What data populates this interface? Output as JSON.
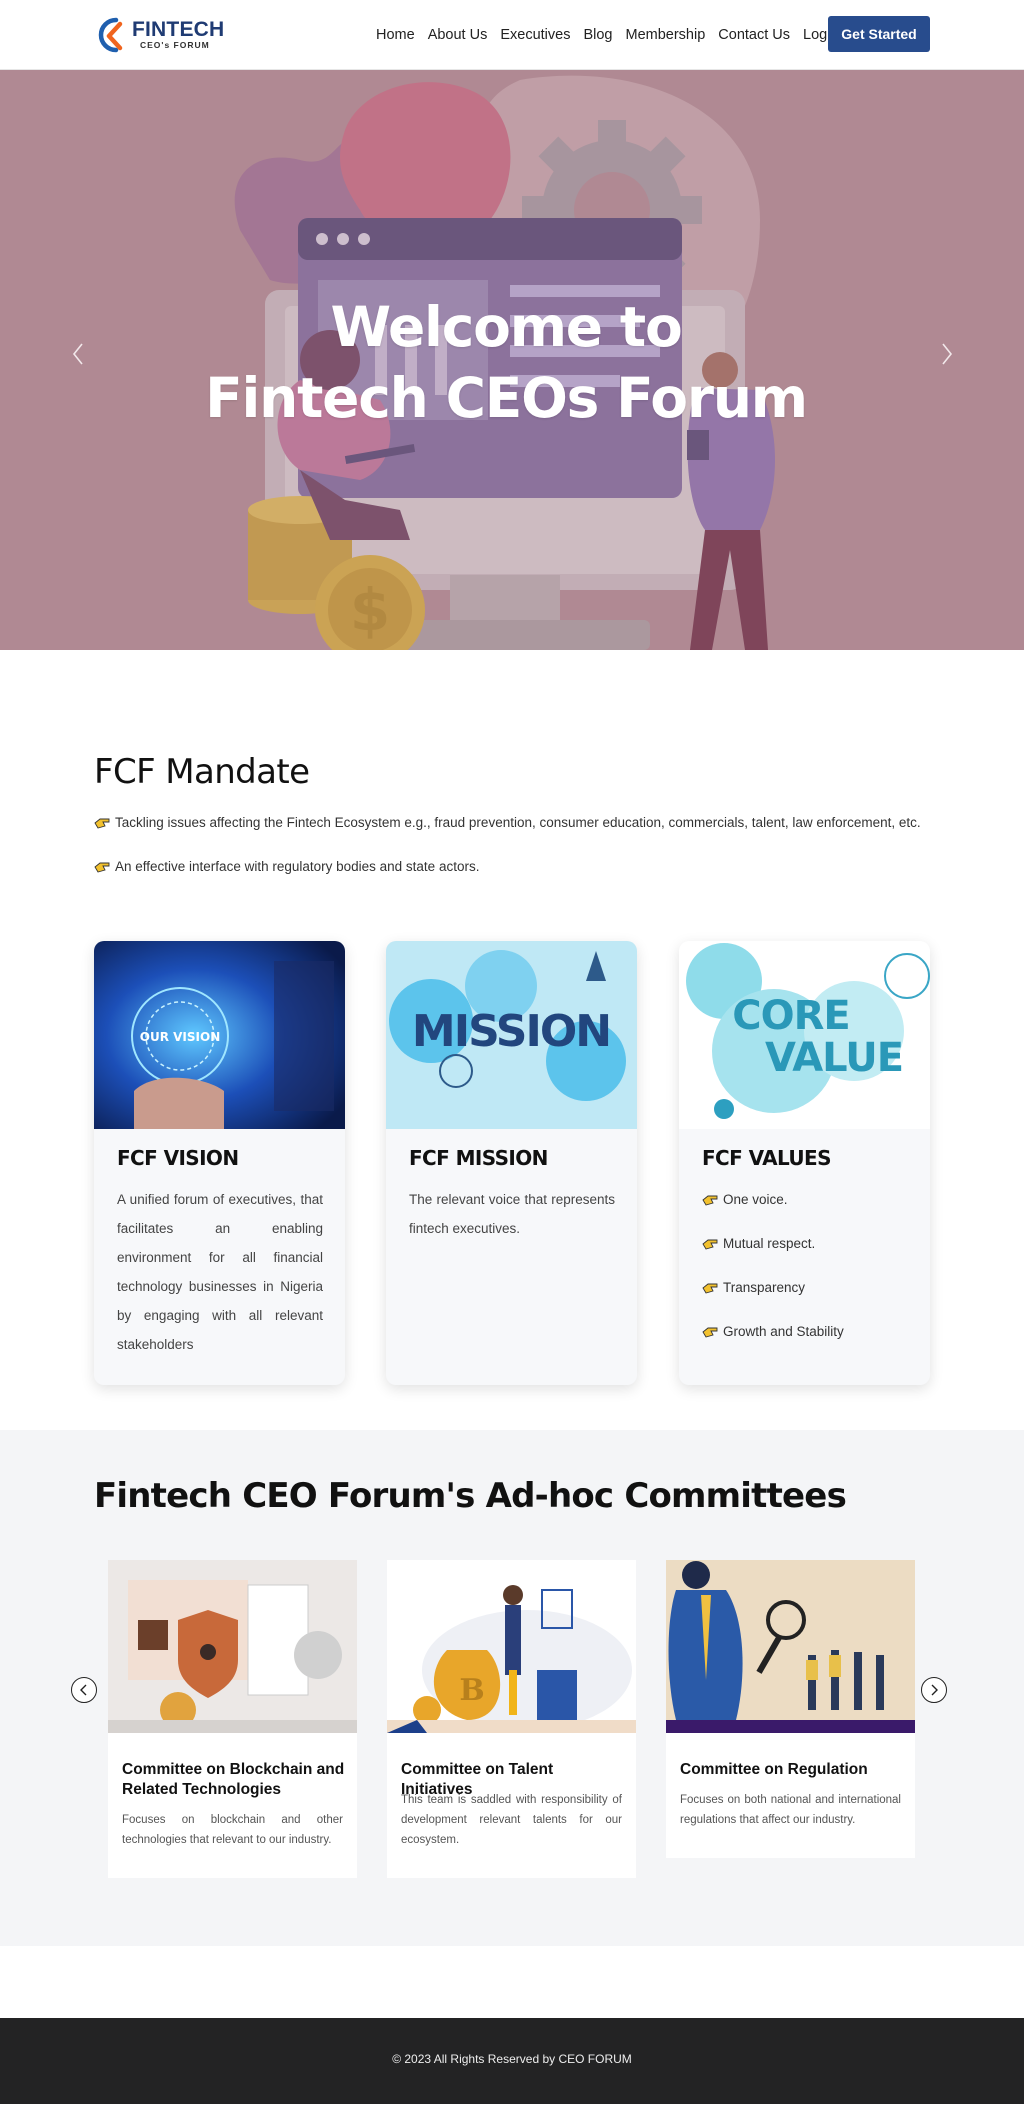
{
  "nav": {
    "logo_title": "FINTECH",
    "logo_subtitle": "CEO's FORUM",
    "links": [
      {
        "label": "Home"
      },
      {
        "label": "About Us"
      },
      {
        "label": "Executives"
      },
      {
        "label": "Blog"
      },
      {
        "label": "Membership"
      },
      {
        "label": "Contact Us"
      },
      {
        "label": "Login"
      }
    ],
    "cta_label": "Get Started",
    "cta_color": "#284c8d"
  },
  "hero": {
    "title_line1": "Welcome to",
    "title_line2": "Fintech CEOs Forum",
    "prev_icon": "chevron-left-icon",
    "next_icon": "chevron-right-icon",
    "overlay_color": "#b08a93"
  },
  "mandate": {
    "title": "FCF Mandate",
    "items": [
      {
        "text": "Tackling issues affecting the Fintech Ecosystem e.g., fraud prevention, consumer education, commercials, talent, law enforcement, etc."
      },
      {
        "text": "An effective interface with regulatory bodies and state actors."
      }
    ],
    "bullet_icon": "pointing-hand-icon"
  },
  "cards": [
    {
      "title": "FCF VISION",
      "image_text": "OUR VISION",
      "text": "A unified forum of executives, that facilitates an enabling environment for all financial technology businesses in Nigeria by engaging with all relevant stakeholders"
    },
    {
      "title": "FCF MISSION",
      "image_text": "MISSION",
      "text": "The relevant voice that represents fintech executives."
    },
    {
      "title": "FCF VALUES",
      "image_text_line1": "CORE",
      "image_text_line2": "VALUE",
      "values": [
        {
          "text": "One voice."
        },
        {
          "text": "Mutual respect."
        },
        {
          "text": "Transparency"
        },
        {
          "text": "Growth and Stability"
        }
      ]
    }
  ],
  "committees": {
    "title": "Fintech CEO Forum's Ad-hoc Committees",
    "items": [
      {
        "title": "Committee on Blockchain and Related Technologies",
        "text": "Focuses on blockchain and other technologies that relevant to our industry."
      },
      {
        "title": "Committee on Talent Initiatives",
        "text": "This team is saddled with responsibility of development relevant talents for our ecosystem."
      },
      {
        "title": "Committee on Regulation",
        "text": "Focuses on both national and international regulations that affect our industry."
      }
    ],
    "prev_icon": "circle-chevron-left-icon",
    "next_icon": "circle-chevron-right-icon"
  },
  "footer": {
    "text": "© 2023 All Rights Reserved by CEO FORUM"
  }
}
